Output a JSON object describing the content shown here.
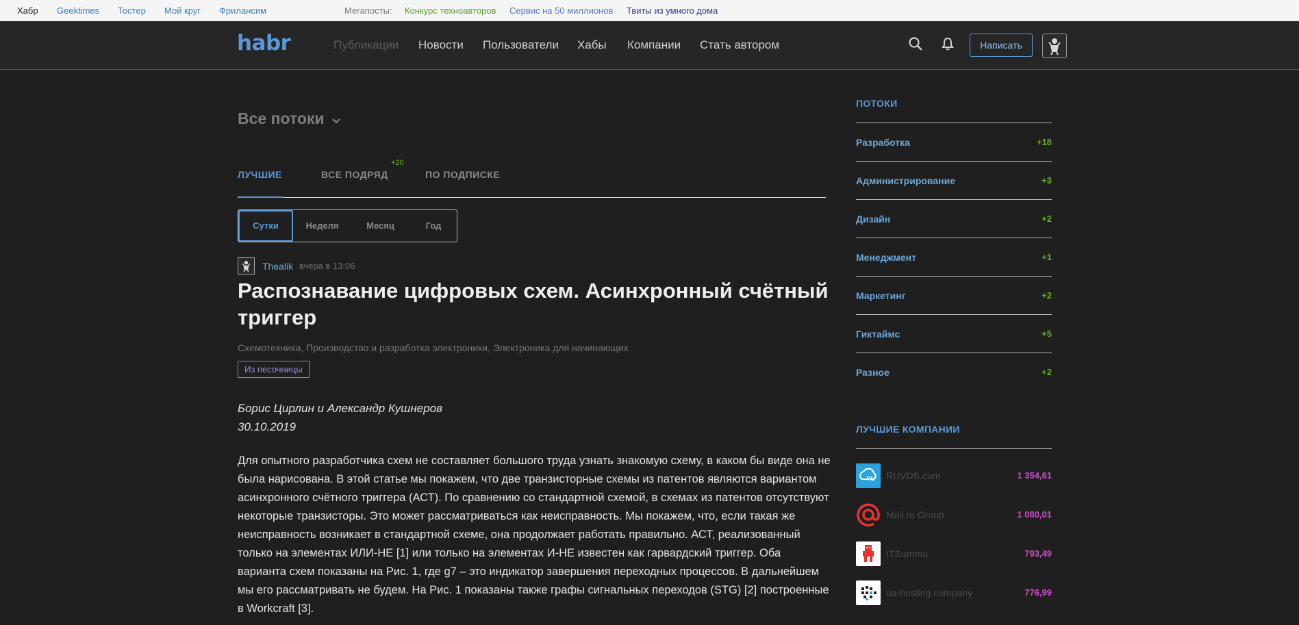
{
  "megabar": {
    "links": [
      "Хабр",
      "Geektimes",
      "Тостер",
      "Мой круг",
      "Фрилансим"
    ],
    "megaposts_label": "Мегапосты:",
    "megaposts": [
      "Конкурс техноавторов",
      "Сервис на 50 миллионов",
      "Твиты из умного дома"
    ]
  },
  "header": {
    "logo": "habr",
    "nav": [
      "Публикации",
      "Новости",
      "Пользователи",
      "Хабы",
      "Компании",
      "Стать автором"
    ],
    "write_label": "Написать",
    "icons": [
      "search-icon",
      "bell-icon",
      "user-avatar-icon"
    ]
  },
  "feed": {
    "title": "Все потоки",
    "tabs": [
      "ЛУЧШИЕ",
      "ВСЕ ПОДРЯД",
      "ПО ПОДПИСКЕ"
    ],
    "new_count": "+20",
    "periods": [
      "Сутки",
      "Неделя",
      "Месяц",
      "Год"
    ]
  },
  "post": {
    "author": "Thealik",
    "time": "вчера в 13:06",
    "title": "Распознавание цифровых схем. Асинхронный счётный триггер",
    "hubs": [
      "Схемотехника,",
      "Производство и разработка электроники,",
      "Электроника для начинающих"
    ],
    "sandbox_label": "Из песочницы",
    "byline": "Борис Цирлин и Александр Кушнеров",
    "date": "30.10.2019",
    "body": "Для опытного разработчика схем не составляет большого труда узнать знакомую схему, в каком бы виде она не была нарисована. В этой статье мы покажем, что две транзисторные схемы из патентов являются вариантом асинхронного счётного триггера (АСТ). По сравнению со стандартной схемой, в схемах из патентов отсутствуют некоторые транзисторы. Это может рассматриваться как неисправность. Мы покажем, что, если такая же неисправность возникает в стандартной схеме, она продолжает работать правильно. АСТ, реализованный только на элементах ИЛИ-НЕ [1] или только на элементах И-НЕ известен как гарвардский триггер. Оба варианта схем показаны на Рис. 1, где g7 – это индикатор завершения переходных процессов. В дальнейшем мы его рассматривать не будем. На Рис. 1 показаны также графы сигнальных переходов (STG) [2] построенные в Workcraft [3]."
  },
  "sidebar": {
    "flows_title": "ПОТОКИ",
    "flows": [
      {
        "name": "Разработка",
        "count": "+18"
      },
      {
        "name": "Администрирование",
        "count": "+3"
      },
      {
        "name": "Дизайн",
        "count": "+2"
      },
      {
        "name": "Менеджмент",
        "count": "+1"
      },
      {
        "name": "Маркетинг",
        "count": "+2"
      },
      {
        "name": "Гиктаймс",
        "count": "+5"
      },
      {
        "name": "Разное",
        "count": "+2"
      }
    ],
    "companies_title": "ЛУЧШИЕ КОМПАНИИ",
    "companies": [
      {
        "name": "RUVDS.com",
        "rating": "1 354,61",
        "logo_color": "#2aa3dc"
      },
      {
        "name": "Mail.ru Group",
        "rating": "1 080,01",
        "logo_color": "#e8322d"
      },
      {
        "name": "ITSumma",
        "rating": "793,49",
        "logo_color": "#ffffff"
      },
      {
        "name": "ua-hosting.company",
        "rating": "776,99",
        "logo_color": "#ffffff"
      }
    ]
  }
}
